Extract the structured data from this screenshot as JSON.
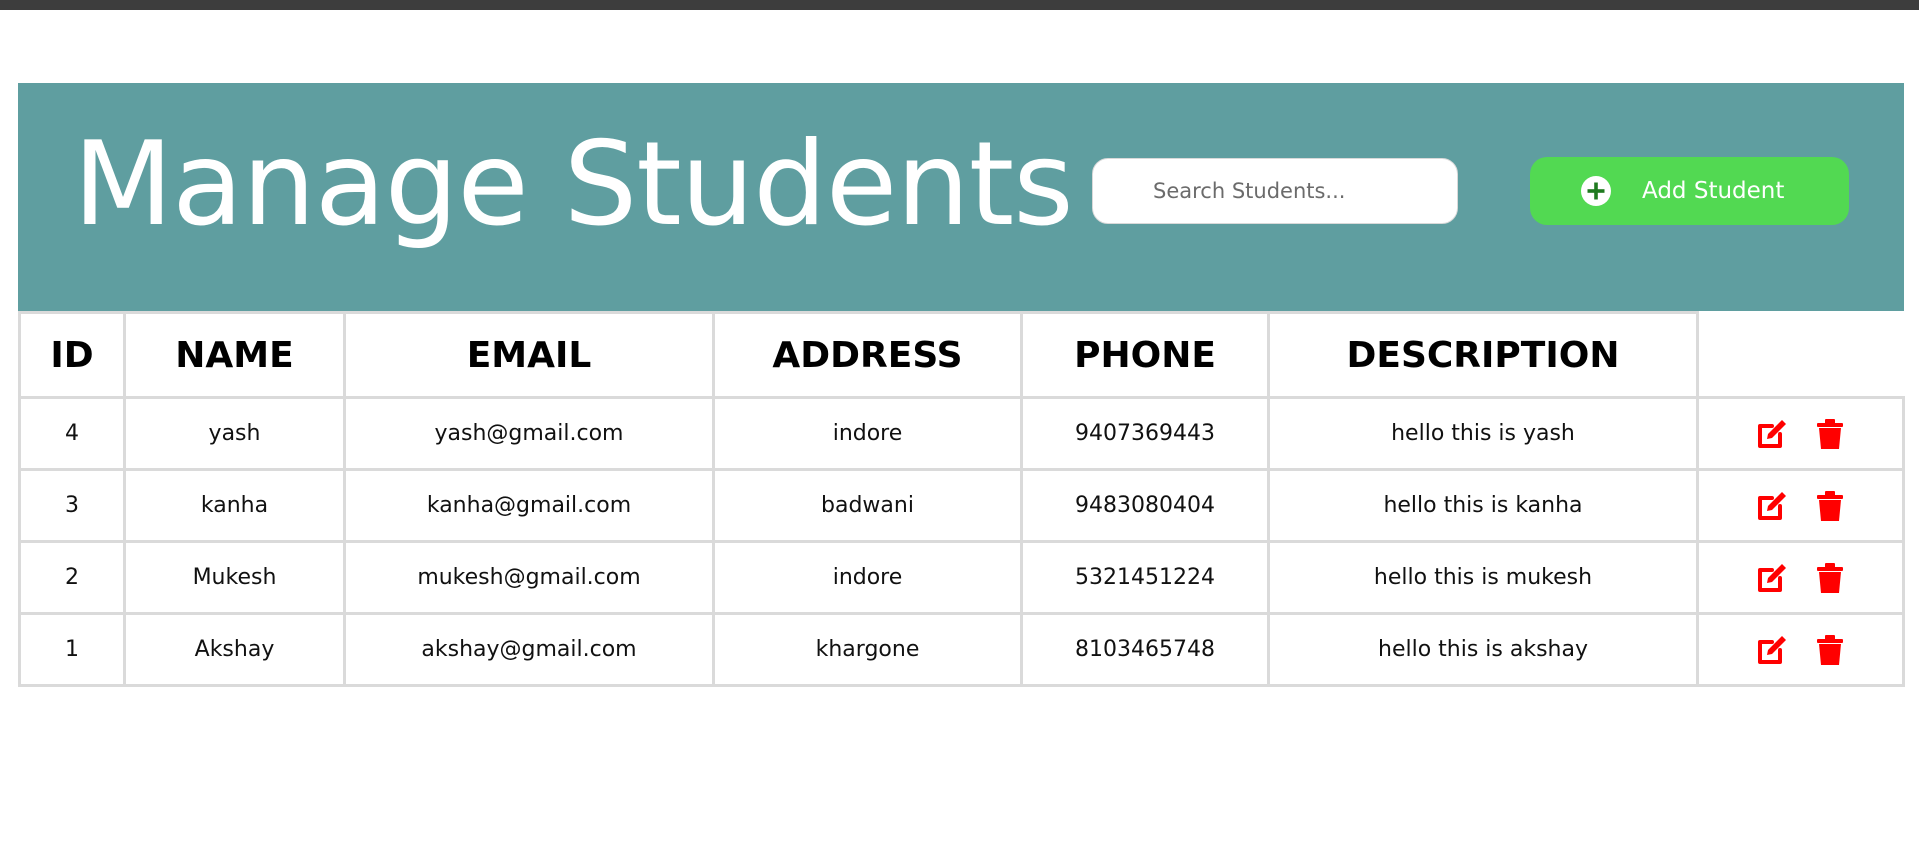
{
  "header": {
    "title": "Manage Students",
    "search_placeholder": "Search Students...",
    "add_button_label": "Add Student",
    "background_color": "#5f9ea0",
    "add_button_color": "#52d952"
  },
  "table": {
    "columns": [
      "ID",
      "NAME",
      "EMAIL",
      "ADDRESS",
      "PHONE",
      "DESCRIPTION",
      ""
    ],
    "rows": [
      {
        "id": "4",
        "name": "yash",
        "email": "yash@gmail.com",
        "address": "indore",
        "phone": "9407369443",
        "description": "hello this is yash"
      },
      {
        "id": "3",
        "name": "kanha",
        "email": "kanha@gmail.com",
        "address": "badwani",
        "phone": "9483080404",
        "description": "hello this is kanha"
      },
      {
        "id": "2",
        "name": "Mukesh",
        "email": "mukesh@gmail.com",
        "address": "indore",
        "phone": "5321451224",
        "description": "hello this is mukesh"
      },
      {
        "id": "1",
        "name": "Akshay",
        "email": "akshay@gmail.com",
        "address": "khargone",
        "phone": "8103465748",
        "description": "hello this is akshay"
      }
    ],
    "row_actions": [
      "edit-icon",
      "trash-icon"
    ],
    "action_color": "#ff0000"
  }
}
